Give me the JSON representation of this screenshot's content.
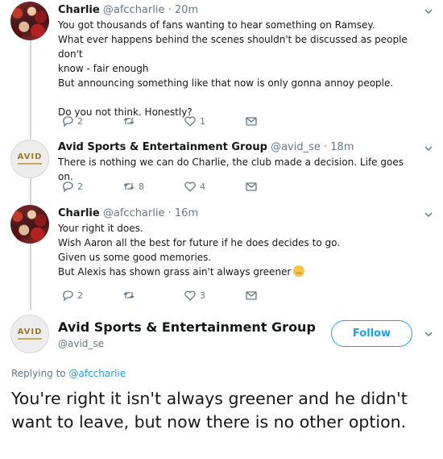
{
  "thread": [
    {
      "name": "Charlie",
      "handle": "@afccharlie",
      "dot": "·",
      "time": "20m",
      "lines": [
        "You got thousands of fans wanting to hear something on Ramsey.",
        "What ever happens behind the scenes shouldn't be discussed as people don't",
        "know - fair enough",
        "But announcing something like that now is only gonna annoy people.",
        "",
        "Do you not think. Honestly?"
      ],
      "replies": "2",
      "retweets": "",
      "likes": "1"
    },
    {
      "name": "Avid Sports & Entertainment Group",
      "handle": "@avid_se",
      "dot": "·",
      "time": "18m",
      "lines": [
        "There is nothing we can do Charlie, the club made a decision. Life goes on."
      ],
      "replies": "2",
      "retweets": "8",
      "likes": "4"
    },
    {
      "name": "Charlie",
      "handle": "@afccharlie",
      "dot": "·",
      "time": "16m",
      "lines": [
        "Your right it does.",
        "Wish Aaron all the best for future if he does decides to go.",
        "Given us some good memories.",
        "But Alexis has shown grass ain't always greener"
      ],
      "replies": "2",
      "retweets": "",
      "likes": "3"
    }
  ],
  "avatar_logo": "AVID",
  "main": {
    "name": "Avid Sports & Entertainment Group",
    "handle": "@avid_se",
    "follow_label": "Follow",
    "replying_prefix": "Replying to",
    "replying_to": "@afccharlie",
    "text": "You're right it isn't always greener and he didn't want to leave, but now there is no other option."
  },
  "icons": {
    "reply": "reply-icon",
    "retweet": "retweet-icon",
    "like": "heart-icon",
    "dm": "envelope-icon",
    "more": "chevron-down-icon",
    "emoji": "smirk-emoji"
  },
  "colors": {
    "accent": "#1da1f2",
    "muted": "#657786",
    "thread_line": "#ccd6dd"
  }
}
